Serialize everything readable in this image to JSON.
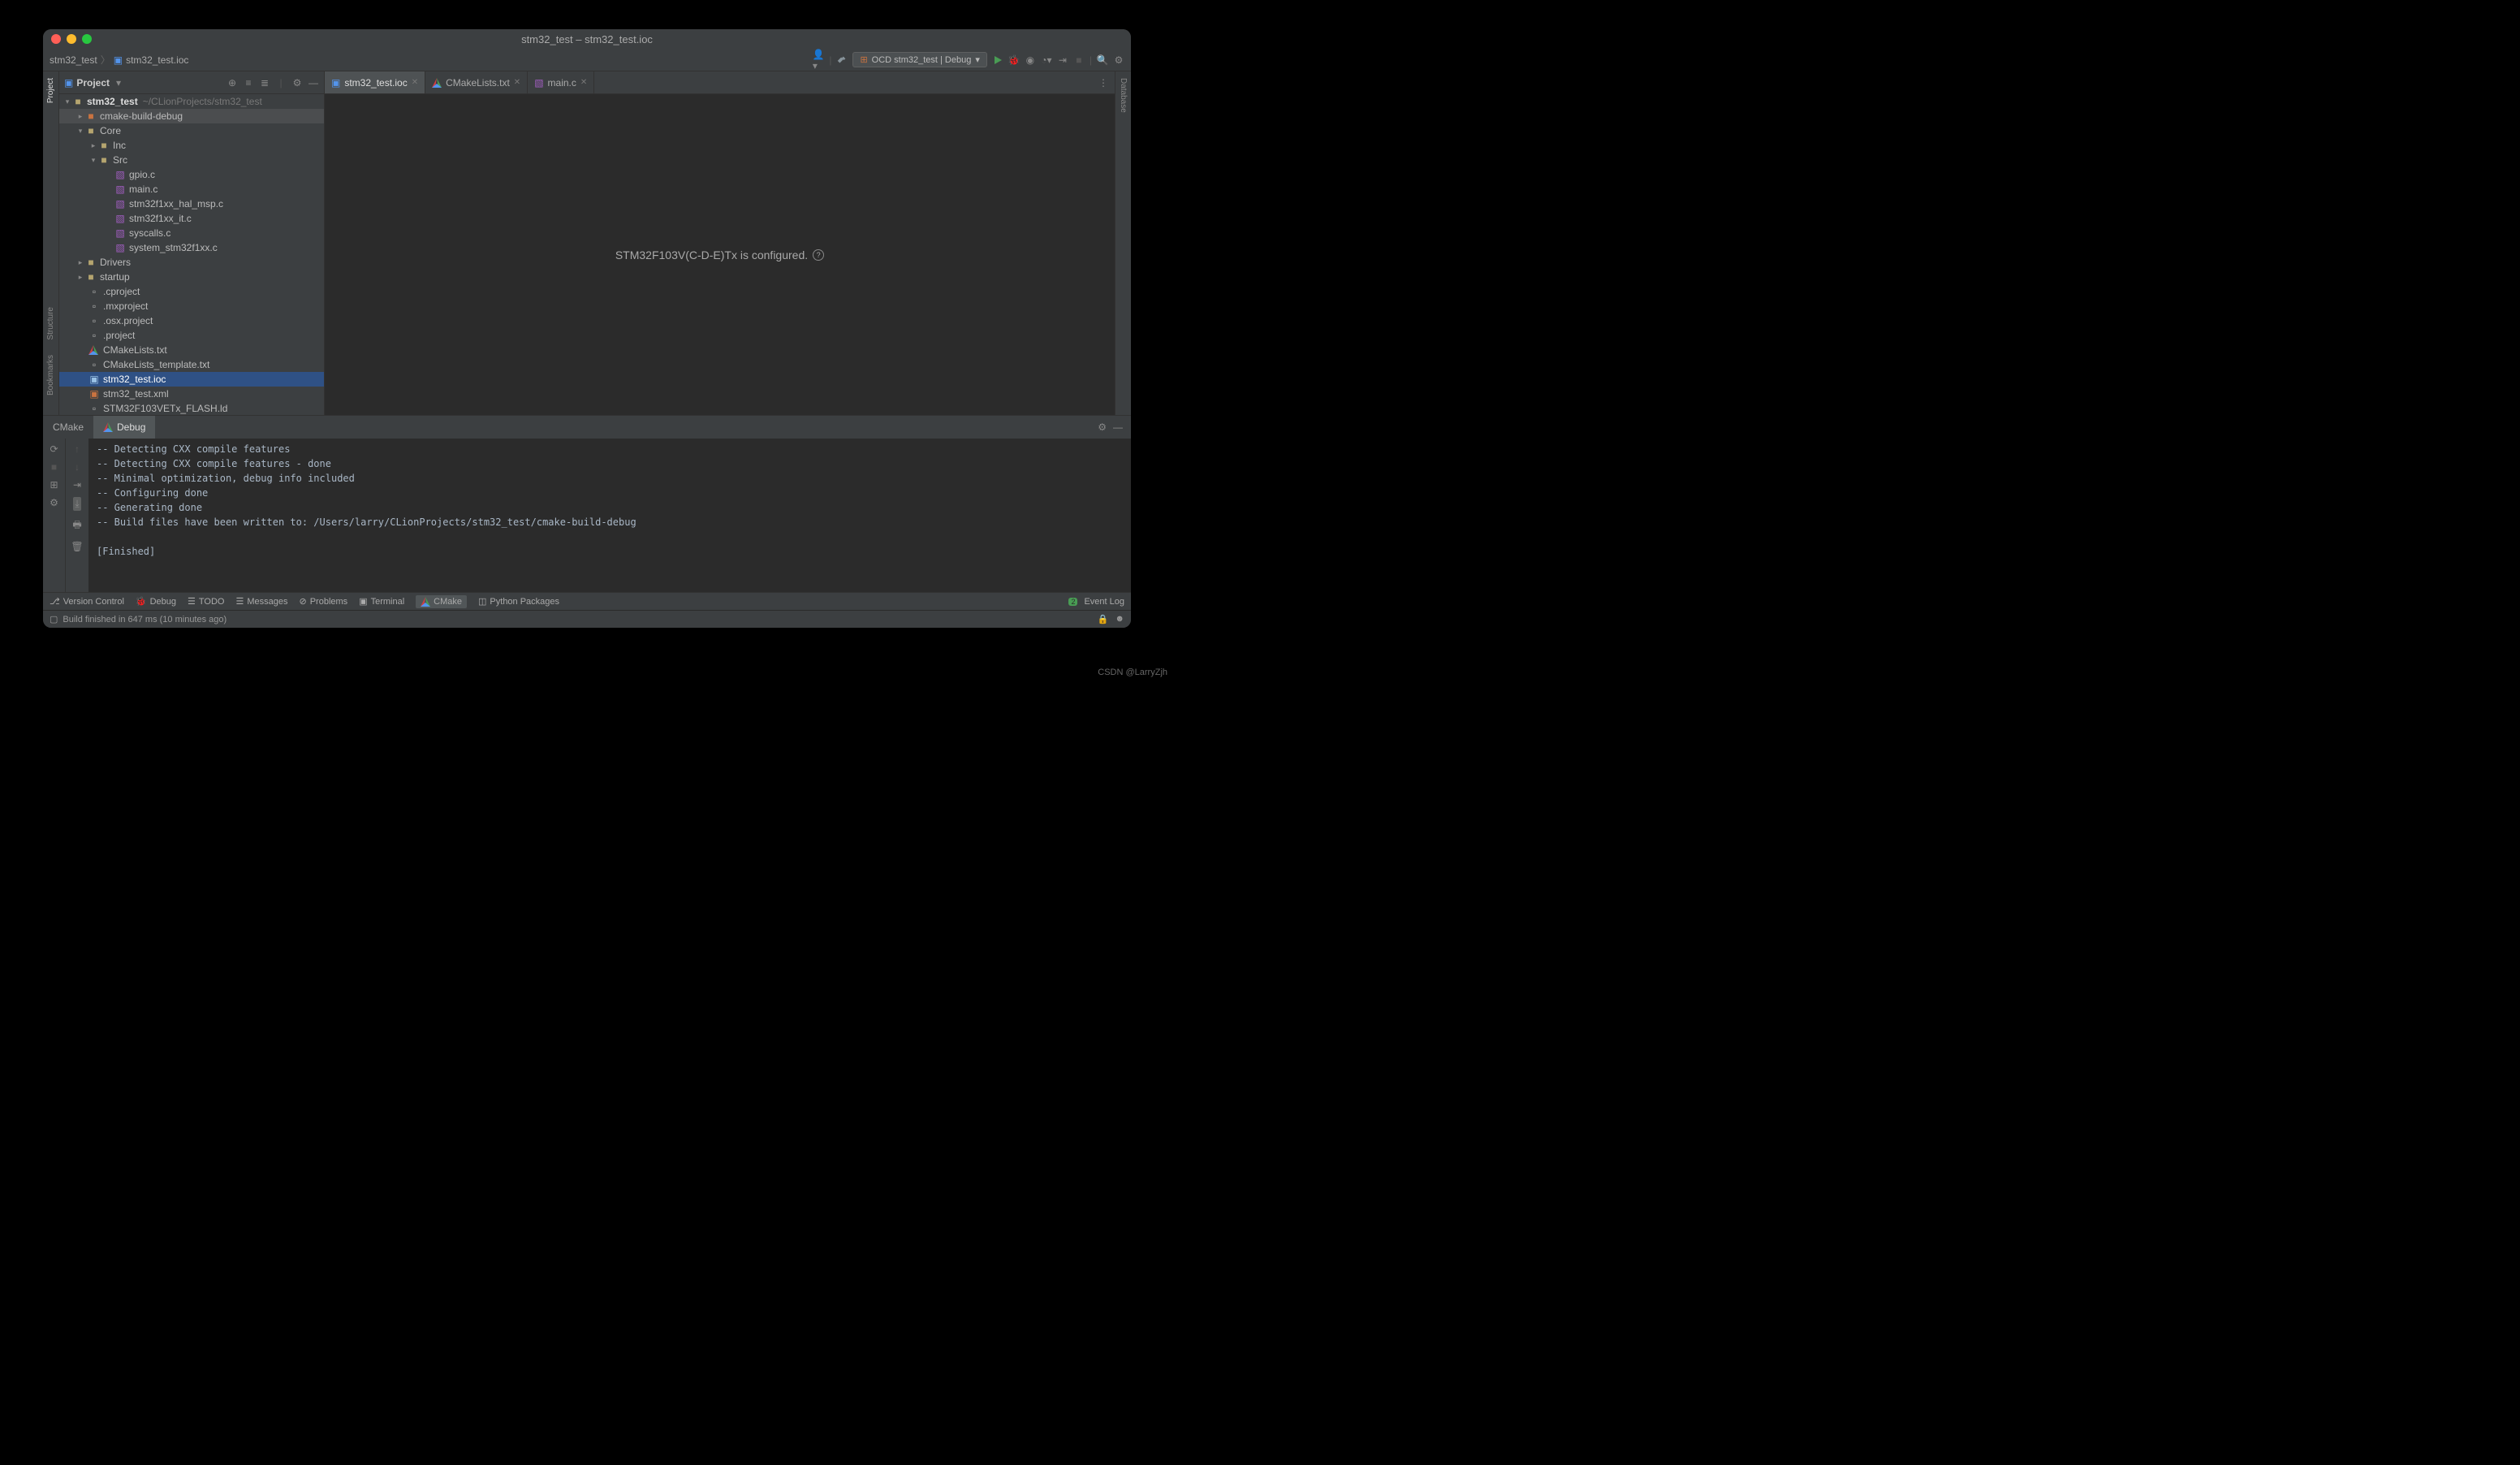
{
  "window_title": "stm32_test – stm32_test.ioc",
  "breadcrumb": {
    "project": "stm32_test",
    "file": "stm32_test.ioc"
  },
  "run_config": "OCD stm32_test | Debug",
  "project_panel": {
    "title": "Project"
  },
  "tree": {
    "root": "stm32_test",
    "root_path": "~/CLionProjects/stm32_test",
    "items": [
      {
        "name": "cmake-build-debug"
      },
      {
        "name": "Core"
      },
      {
        "name": "Inc"
      },
      {
        "name": "Src"
      },
      {
        "name": "gpio.c"
      },
      {
        "name": "main.c"
      },
      {
        "name": "stm32f1xx_hal_msp.c"
      },
      {
        "name": "stm32f1xx_it.c"
      },
      {
        "name": "syscalls.c"
      },
      {
        "name": "system_stm32f1xx.c"
      },
      {
        "name": "Drivers"
      },
      {
        "name": "startup"
      },
      {
        "name": ".cproject"
      },
      {
        "name": ".mxproject"
      },
      {
        "name": ".osx.project"
      },
      {
        "name": ".project"
      },
      {
        "name": "CMakeLists.txt"
      },
      {
        "name": "CMakeLists_template.txt"
      },
      {
        "name": "stm32_test.ioc"
      },
      {
        "name": "stm32_test.xml"
      },
      {
        "name": "STM32F103VETx_FLASH.ld"
      }
    ]
  },
  "editor_tabs": [
    {
      "label": "stm32_test.ioc"
    },
    {
      "label": "CMakeLists.txt"
    },
    {
      "label": "main.c"
    }
  ],
  "editor_message": "STM32F103V(C-D-E)Tx is configured.",
  "bottom_tabs": {
    "cmake": "CMake",
    "debug": "Debug"
  },
  "console_lines": [
    "-- Detecting CXX compile features",
    "-- Detecting CXX compile features - done",
    "-- Minimal optimization, debug info included",
    "-- Configuring done",
    "-- Generating done",
    "-- Build files have been written to: /Users/larry/CLionProjects/stm32_test/cmake-build-debug",
    "",
    "[Finished]"
  ],
  "tool_windows": {
    "vcs": "Version Control",
    "debug": "Debug",
    "todo": "TODO",
    "messages": "Messages",
    "problems": "Problems",
    "terminal": "Terminal",
    "cmake": "CMake",
    "python": "Python Packages",
    "eventlog": "Event Log"
  },
  "status_text": "Build finished in 647 ms (10 minutes ago)",
  "left_strip": {
    "project": "Project",
    "structure": "Structure",
    "bookmarks": "Bookmarks"
  },
  "right_strip": {
    "database": "Database"
  },
  "watermark": "CSDN @LarryZjh",
  "event_badge": "2"
}
